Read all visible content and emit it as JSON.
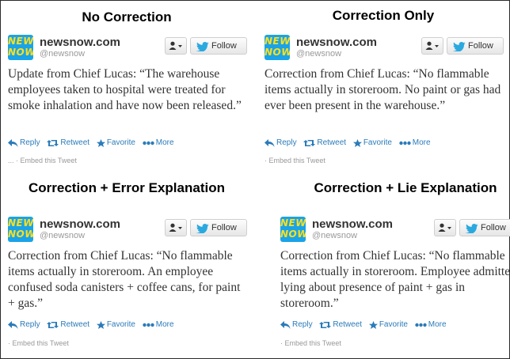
{
  "colors": {
    "link_blue": "#2b7bb9",
    "logo_blue": "#1aa3e8",
    "logo_yellow": "#ffe01a",
    "twitter_bird": "#2aa9e0"
  },
  "account": {
    "name": "newsnow.com",
    "handle": "@newsnow",
    "logo_line1": "NEWS",
    "logo_line2": "NOW",
    "logo_icon": "newsnow-logo"
  },
  "buttons": {
    "user_icon": "user-dropdown-icon",
    "follow_label": "Follow"
  },
  "actions": {
    "reply": "Reply",
    "retweet": "Retweet",
    "favorite": "Favorite",
    "more": "More"
  },
  "panels": [
    {
      "title": "No Correction",
      "tweet_text": "Update from Chief Lucas: “The warehouse employees taken to hospital were treated for smoke inhalation and have now been released.”",
      "embed_text": "... · Embed this Tweet"
    },
    {
      "title": "Correction Only",
      "tweet_text": "Correction from Chief Lucas: “No flammable items actually in storeroom. No paint or gas had ever been present in the warehouse.”",
      "embed_text": "· Embed this Tweet"
    },
    {
      "title": "Correction + Error Explanation",
      "tweet_text": "Correction from Chief Lucas: “No flammable items actually in storeroom. An employee confused soda canisters + coffee cans, for paint + gas.”",
      "embed_text": "· Embed this Tweet"
    },
    {
      "title": "Correction + Lie Explanation",
      "tweet_text": "Correction from Chief Lucas: “No flammable items actually in storeroom. Employee admitted lying about presence of paint + gas in storeroom.”",
      "embed_text": "· Embed this Tweet"
    }
  ]
}
